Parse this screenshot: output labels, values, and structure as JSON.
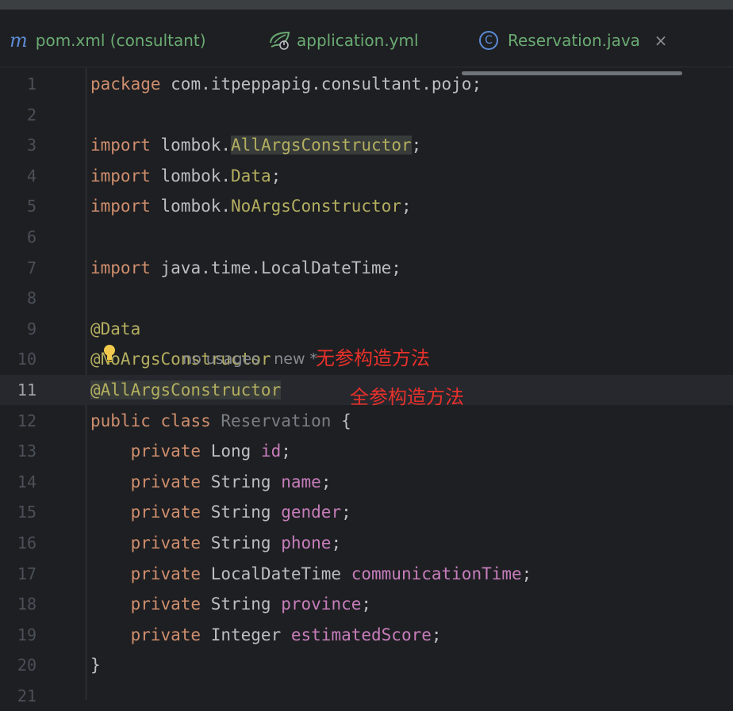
{
  "tabs": [
    {
      "label": "pom.xml (consultant)",
      "icon": "maven-icon"
    },
    {
      "label": "application.yml",
      "icon": "spring-leaf-icon"
    },
    {
      "label": "Reservation.java",
      "icon": "class-icon",
      "active": true
    }
  ],
  "tab_icons": {
    "maven_glyph": "m",
    "class_glyph": "C",
    "close_glyph": "×"
  },
  "hints": {
    "usages": "no usages",
    "author": "new *"
  },
  "annotations": [
    "无参构造方法",
    "全参构造方法"
  ],
  "editor": {
    "current_line": 11,
    "lines": [
      {
        "n": "1",
        "tokens": [
          {
            "t": "package ",
            "c": "kw"
          },
          {
            "t": "com.itpeppapig.consultant.pojo;",
            "c": ""
          }
        ]
      },
      {
        "n": "2",
        "tokens": []
      },
      {
        "n": "3",
        "tokens": [
          {
            "t": "import ",
            "c": "kw"
          },
          {
            "t": "lombok.",
            "c": ""
          },
          {
            "t": "AllArgsConstructor",
            "c": "ann hl-box"
          },
          {
            "t": ";",
            "c": ""
          }
        ]
      },
      {
        "n": "4",
        "tokens": [
          {
            "t": "import ",
            "c": "kw"
          },
          {
            "t": "lombok.",
            "c": ""
          },
          {
            "t": "Data",
            "c": "ann"
          },
          {
            "t": ";",
            "c": ""
          }
        ]
      },
      {
        "n": "5",
        "tokens": [
          {
            "t": "import ",
            "c": "kw"
          },
          {
            "t": "lombok.",
            "c": ""
          },
          {
            "t": "NoArgsConstructor",
            "c": "ann"
          },
          {
            "t": ";",
            "c": ""
          }
        ]
      },
      {
        "n": "6",
        "tokens": []
      },
      {
        "n": "7",
        "tokens": [
          {
            "t": "import ",
            "c": "kw"
          },
          {
            "t": "java.time.LocalDateTime;",
            "c": ""
          }
        ]
      },
      {
        "n": "8",
        "tokens": []
      },
      {
        "n": "9",
        "tokens": [
          {
            "t": "@Data",
            "c": "ann"
          }
        ]
      },
      {
        "n": "10",
        "tokens": [
          {
            "t": "@NoArgsConstructor",
            "c": "ann"
          }
        ]
      },
      {
        "n": "11",
        "tokens": [
          {
            "t": "@AllArgsConstructor",
            "c": "ann hl-box"
          }
        ]
      },
      {
        "n": "12",
        "tokens": [
          {
            "t": "public ",
            "c": "kw"
          },
          {
            "t": "class ",
            "c": "kw"
          },
          {
            "t": "Reservation",
            "c": "dim"
          },
          {
            "t": " {",
            "c": ""
          }
        ]
      },
      {
        "n": "13",
        "tokens": [
          {
            "t": "    private ",
            "c": "kw"
          },
          {
            "t": "Long ",
            "c": ""
          },
          {
            "t": "id",
            "c": "fld"
          },
          {
            "t": ";",
            "c": ""
          }
        ]
      },
      {
        "n": "14",
        "tokens": [
          {
            "t": "    private ",
            "c": "kw"
          },
          {
            "t": "String ",
            "c": ""
          },
          {
            "t": "name",
            "c": "fld"
          },
          {
            "t": ";",
            "c": ""
          }
        ]
      },
      {
        "n": "15",
        "tokens": [
          {
            "t": "    private ",
            "c": "kw"
          },
          {
            "t": "String ",
            "c": ""
          },
          {
            "t": "gender",
            "c": "fld"
          },
          {
            "t": ";",
            "c": ""
          }
        ]
      },
      {
        "n": "16",
        "tokens": [
          {
            "t": "    private ",
            "c": "kw"
          },
          {
            "t": "String ",
            "c": ""
          },
          {
            "t": "phone",
            "c": "fld"
          },
          {
            "t": ";",
            "c": ""
          }
        ]
      },
      {
        "n": "17",
        "tokens": [
          {
            "t": "    private ",
            "c": "kw"
          },
          {
            "t": "LocalDateTime ",
            "c": ""
          },
          {
            "t": "communicationTime",
            "c": "fld"
          },
          {
            "t": ";",
            "c": ""
          }
        ]
      },
      {
        "n": "18",
        "tokens": [
          {
            "t": "    private ",
            "c": "kw"
          },
          {
            "t": "String ",
            "c": ""
          },
          {
            "t": "province",
            "c": "fld"
          },
          {
            "t": ";",
            "c": ""
          }
        ]
      },
      {
        "n": "19",
        "tokens": [
          {
            "t": "    private ",
            "c": "kw"
          },
          {
            "t": "Integer ",
            "c": ""
          },
          {
            "t": "estimatedScore",
            "c": "fld"
          },
          {
            "t": ";",
            "c": ""
          }
        ]
      },
      {
        "n": "20",
        "tokens": [
          {
            "t": "}",
            "c": ""
          }
        ]
      },
      {
        "n": "21",
        "tokens": []
      }
    ]
  },
  "colors": {
    "background": "#1e1f22",
    "keyword": "#cf8e6d",
    "annotation": "#b3ae60",
    "field": "#c77dbb",
    "default_text": "#bcbec4",
    "tab_label": "#6aab73",
    "red_note": "#e8312b"
  }
}
